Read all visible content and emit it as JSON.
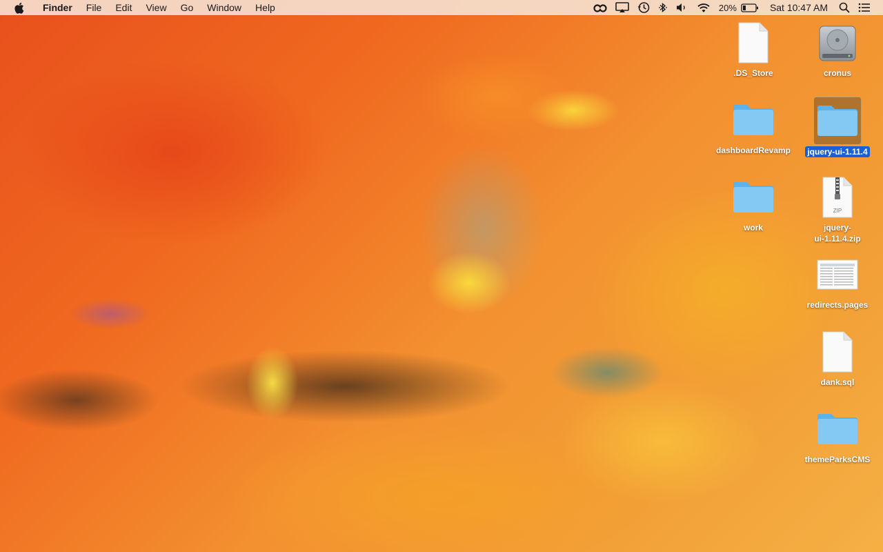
{
  "menubar": {
    "app_name": "Finder",
    "items": [
      "File",
      "Edit",
      "View",
      "Go",
      "Window",
      "Help"
    ],
    "battery_percent": "20%",
    "clock": "Sat 10:47 AM",
    "status_icons": [
      "creative-cloud-icon",
      "airplay-icon",
      "time-machine-icon",
      "bluetooth-icon",
      "volume-icon",
      "wifi-icon",
      "battery-icon",
      "spotlight-icon",
      "notification-center-icon"
    ]
  },
  "desktop": {
    "icons": [
      {
        "label": ".DS_Store",
        "kind": "document",
        "selected": false
      },
      {
        "label": "cronus",
        "kind": "hard-drive",
        "selected": false
      },
      {
        "label": "dashboardRevamp",
        "kind": "folder",
        "selected": false
      },
      {
        "label": "jquery-ui-1.11.4",
        "kind": "folder",
        "selected": true
      },
      {
        "label": "work",
        "kind": "folder",
        "selected": false
      },
      {
        "label": "jquery-ui-1.11.4.zip",
        "label_line1": "jquery-",
        "label_line2": "ui-1.11.4.zip",
        "kind": "zip",
        "badge": "ZIP",
        "selected": false
      },
      {
        "label": "redirects.pages",
        "kind": "pages-document",
        "selected": false
      },
      {
        "label": "dank.sql",
        "kind": "document",
        "selected": false
      },
      {
        "label": "themeParksCMS",
        "kind": "folder",
        "selected": false
      }
    ]
  },
  "colors": {
    "selection": "#1b5fd4",
    "folder": "#79c4f2",
    "menubar_bg": "#f5decd"
  }
}
